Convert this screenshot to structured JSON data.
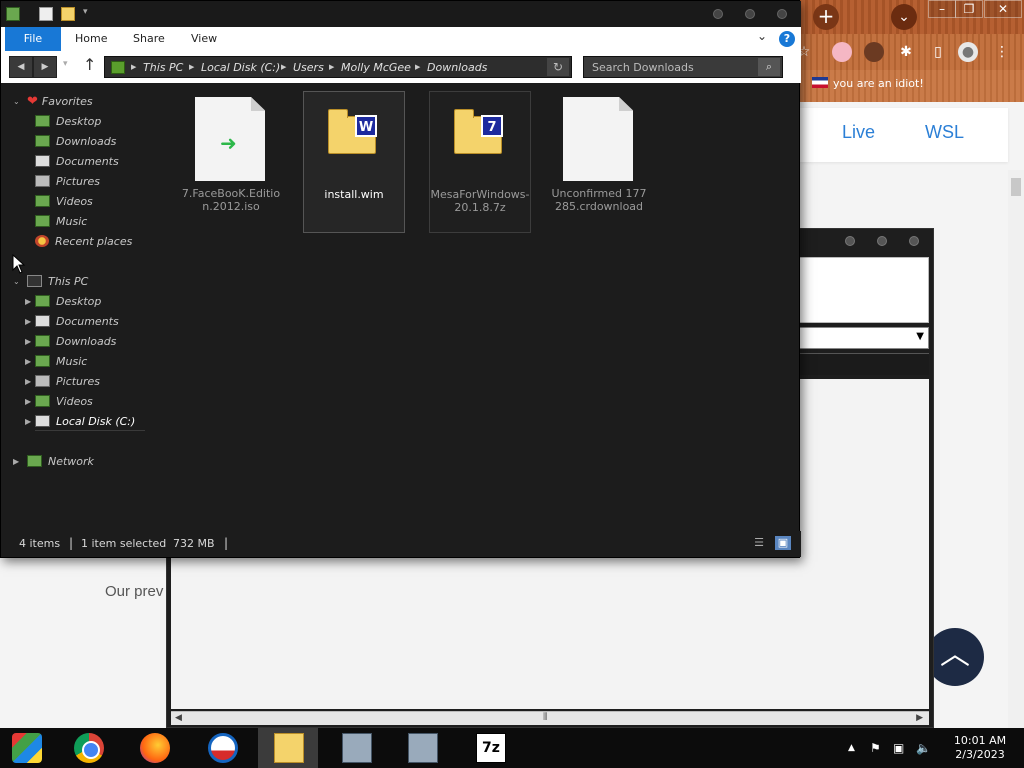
{
  "explorer": {
    "ribbon": {
      "file": "File",
      "home": "Home",
      "share": "Share",
      "view": "View",
      "help": "?"
    },
    "address": [
      "This PC",
      "Local Disk (C:)",
      "Users",
      "Molly McGee",
      "Downloads"
    ],
    "search_placeholder": "Search Downloads",
    "nav": {
      "favorites": "Favorites",
      "fav_items": [
        "Desktop",
        "Downloads",
        "Documents",
        "Pictures",
        "Videos",
        "Music",
        "Recent places"
      ],
      "this_pc": "This PC",
      "pc_items": [
        "Desktop",
        "Documents",
        "Downloads",
        "Music",
        "Pictures",
        "Videos",
        "Local Disk (C:)"
      ],
      "network": "Network"
    },
    "files": [
      {
        "name": "7.FaceBooK.Edition.2012.iso",
        "badge": ""
      },
      {
        "name": "install.wim",
        "badge": "W"
      },
      {
        "name": "MesaForWindows-20.1.8.7z",
        "badge": "7"
      },
      {
        "name": "Unconfirmed 177285.crdownload",
        "badge": ""
      }
    ],
    "status": {
      "count": "4 items",
      "selected": "1 item selected",
      "size": "732 MB"
    }
  },
  "browser": {
    "bookmark": "you are an idiot!",
    "nav_links": [
      "Live",
      "WSL"
    ],
    "page_text": "Our prev"
  },
  "taskbar": {
    "seven_zip": "7z",
    "time": "10:01 AM",
    "date": "2/3/2023"
  },
  "colors": {
    "accent": "#1878d6",
    "explorer_bg": "#1c1c1c",
    "taskbar_bg": "#0c0c0c"
  }
}
